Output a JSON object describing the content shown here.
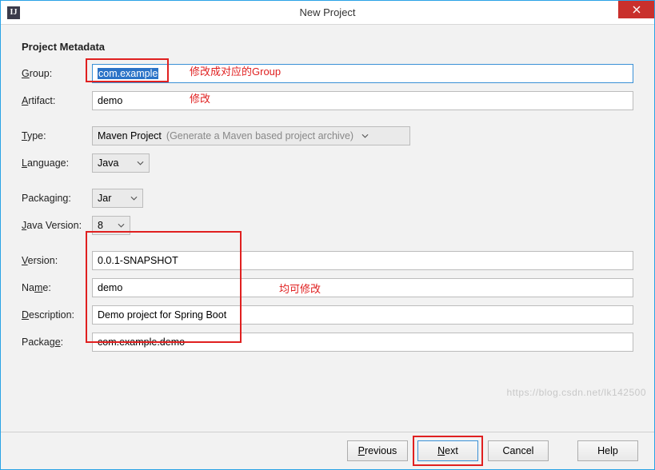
{
  "window": {
    "title": "New Project"
  },
  "heading": "Project Metadata",
  "labels": {
    "group": "Group:",
    "artifact": "Artifact:",
    "type": "Type:",
    "language": "Language:",
    "packaging": "Packaging:",
    "java_version": "Java Version:",
    "version": "Version:",
    "name": "Name:",
    "description": "Description:",
    "package": "Package:"
  },
  "fields": {
    "group": "com.example",
    "artifact": "demo",
    "type": {
      "value": "Maven Project",
      "hint": "(Generate a Maven based project archive)"
    },
    "language": "Java",
    "packaging": "Jar",
    "java_version": "8",
    "version": "0.0.1-SNAPSHOT",
    "name": "demo",
    "description": "Demo project for Spring Boot",
    "package": "com.example.demo"
  },
  "annotations": {
    "group": "修改成对应的Group",
    "artifact": "修改",
    "middle": "均可修改"
  },
  "buttons": {
    "previous": "Previous",
    "next": "Next",
    "cancel": "Cancel",
    "help": "Help"
  },
  "watermark": "https://blog.csdn.net/lk142500"
}
